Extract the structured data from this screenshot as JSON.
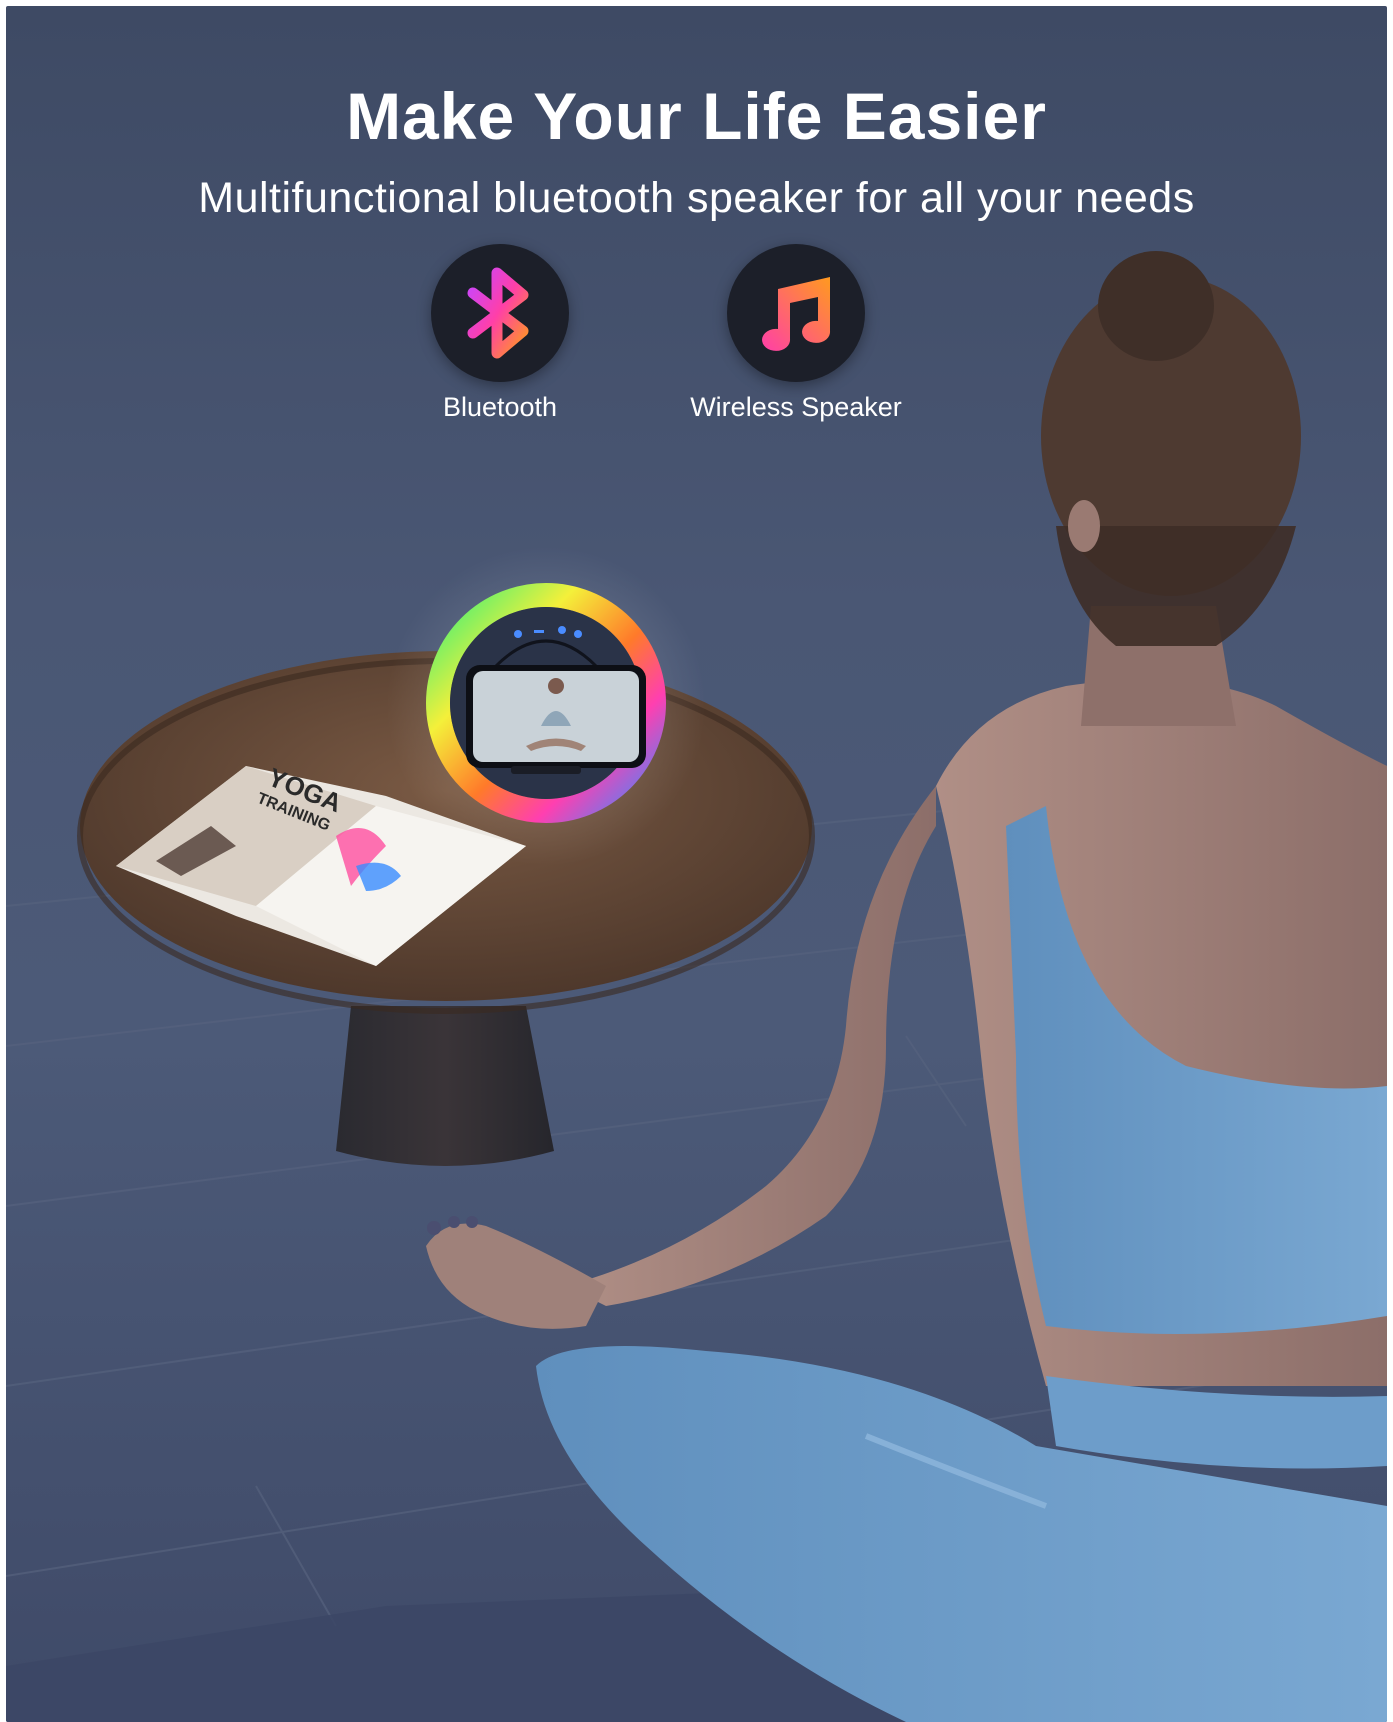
{
  "headline": "Make Your Life Easier",
  "subheadline": "Multifunctional bluetooth speaker for all your needs",
  "features": [
    {
      "label": "Bluetooth",
      "icon": "bluetooth-icon"
    },
    {
      "label": "Wireless Speaker",
      "icon": "music-note-icon"
    }
  ],
  "book": {
    "title_line1": "YOGA",
    "title_line2": "TRAINING"
  },
  "colors": {
    "background": "#475470",
    "text": "#ffffff",
    "badge": "#1c1f29",
    "icon_gradient_start": "#ff3fa8",
    "icon_gradient_end": "#ff9a1f",
    "outfit": "#6c9cc7",
    "table_wood": "#6b4e3a"
  }
}
